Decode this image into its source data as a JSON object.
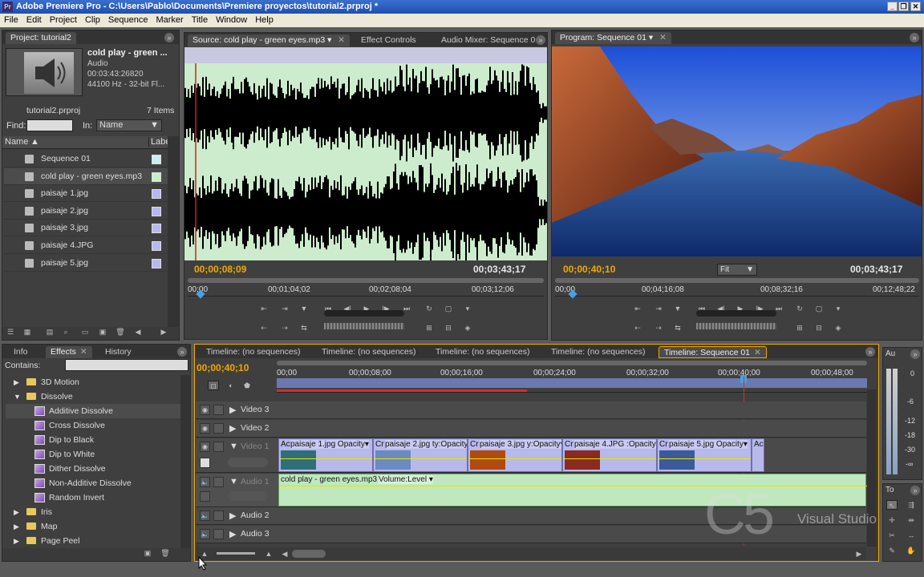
{
  "window": {
    "title": "Adobe Premiere Pro - C:\\Users\\Pablo\\Documents\\Premiere proyectos\\tutorial2.prproj *",
    "app_icon": "Pr"
  },
  "menu": [
    "File",
    "Edit",
    "Project",
    "Clip",
    "Sequence",
    "Marker",
    "Title",
    "Window",
    "Help"
  ],
  "project": {
    "tab": "Project: tutorial2",
    "preview": {
      "name": "cold play - green ...",
      "type": "Audio",
      "duration": "00:03:43:26820",
      "format": "44100 Hz - 32-bit Fl..."
    },
    "file": "tutorial2.prproj",
    "count": "7 Items",
    "find_label": "Find:",
    "in_label": "In:",
    "in_value": "Name",
    "col_name": "Name",
    "col_label": "Labe",
    "items": [
      {
        "name": "Sequence 01",
        "icon": "sequence-icon",
        "color": "#c8f0f0"
      },
      {
        "name": "cold play - green eyes.mp3",
        "icon": "audio-icon",
        "color": "#c8f0c8"
      },
      {
        "name": "paisaje 1.jpg",
        "icon": "image-icon",
        "color": "#b8b8f0"
      },
      {
        "name": "paisaje 2.jpg",
        "icon": "image-icon",
        "color": "#b8b8f0"
      },
      {
        "name": "paisaje 3.jpg",
        "icon": "image-icon",
        "color": "#b8b8f0"
      },
      {
        "name": "paisaje 4.JPG",
        "icon": "image-icon",
        "color": "#b8b8f0"
      },
      {
        "name": "paisaje 5.jpg",
        "icon": "image-icon",
        "color": "#b8b8f0"
      }
    ]
  },
  "source": {
    "tabs": [
      "Source: cold play - green eyes.mp3",
      "Effect Controls",
      "Audio Mixer: Sequence 01"
    ],
    "tc_current": "00;00;08;09",
    "tc_duration": "00;03;43;17",
    "ruler": [
      "00;00",
      "00;01;04;02",
      "00;02;08;04",
      "00;03;12;06"
    ]
  },
  "program": {
    "tab": "Program: Sequence 01",
    "tc_current": "00;00;40;10",
    "tc_duration": "00;03;43;17",
    "fit": "Fit",
    "ruler": [
      "00;00",
      "00;04;16;08",
      "00;08;32;16",
      "00;12;48;22"
    ]
  },
  "effects": {
    "tabs": [
      "Info",
      "Effects",
      "History"
    ],
    "contains_label": "Contains:",
    "items": [
      {
        "label": "3D Motion",
        "kind": "folder",
        "level": 1,
        "open": false
      },
      {
        "label": "Dissolve",
        "kind": "folder",
        "level": 1,
        "open": true
      },
      {
        "label": "Additive Dissolve",
        "kind": "effect",
        "level": 2
      },
      {
        "label": "Cross Dissolve",
        "kind": "effect",
        "level": 2
      },
      {
        "label": "Dip to Black",
        "kind": "effect",
        "level": 2
      },
      {
        "label": "Dip to White",
        "kind": "effect",
        "level": 2
      },
      {
        "label": "Dither Dissolve",
        "kind": "effect",
        "level": 2
      },
      {
        "label": "Non-Additive Dissolve",
        "kind": "effect",
        "level": 2
      },
      {
        "label": "Random Invert",
        "kind": "effect",
        "level": 2
      },
      {
        "label": "Iris",
        "kind": "folder",
        "level": 1,
        "open": false
      },
      {
        "label": "Map",
        "kind": "folder",
        "level": 1,
        "open": false
      },
      {
        "label": "Page Peel",
        "kind": "folder",
        "level": 1,
        "open": false
      }
    ]
  },
  "timeline": {
    "tabs": [
      "Timeline: (no sequences)",
      "Timeline: (no sequences)",
      "Timeline: (no sequences)",
      "Timeline: (no sequences)",
      "Timeline: Sequence 01"
    ],
    "tc": "00;00;40;10",
    "ruler": [
      "00;00",
      "00;00;08;00",
      "00;00;16;00",
      "00;00;24;00",
      "00;00;32;00",
      "00;00;40;00",
      "00;00;48;00"
    ],
    "tracks": {
      "v3": "Video 3",
      "v2": "Video 2",
      "v1": "Video 1",
      "a1": "Audio 1",
      "a2": "Audio 2",
      "a3": "Audio 3"
    },
    "clips": [
      {
        "label": "paisaje 1.jpg  Opacity▾",
        "pre": "Ac",
        "thumb": "#2f6f7a"
      },
      {
        "label": "paisaje 2.jpg  ty:Opacity▾",
        "pre": "Cr",
        "thumb": "#6a8ac0"
      },
      {
        "label": "paisaje 3.jpg  y:Opacity▾",
        "pre": "Cr",
        "thumb": "#b04a10"
      },
      {
        "label": "paisaje 4.JPG  :Opacity▾",
        "pre": "Cr",
        "thumb": "#8a2a20"
      },
      {
        "label": "paisaje 5.jpg  Opacity▾",
        "pre": "Cr",
        "thumb": "#3a5a9a"
      }
    ],
    "clip_tail": "Ac",
    "audio_clip": "cold play - green eyes.mp3",
    "audio_fx": "Volume:Level ▾"
  },
  "audio_meter": {
    "tab": "Au",
    "scale": [
      "0",
      "-6",
      "-12",
      "-18",
      "-30",
      "-∞"
    ]
  },
  "tools": {
    "tab": "To"
  },
  "watermark": {
    "big": "C5",
    "small": "Visual Studio"
  }
}
